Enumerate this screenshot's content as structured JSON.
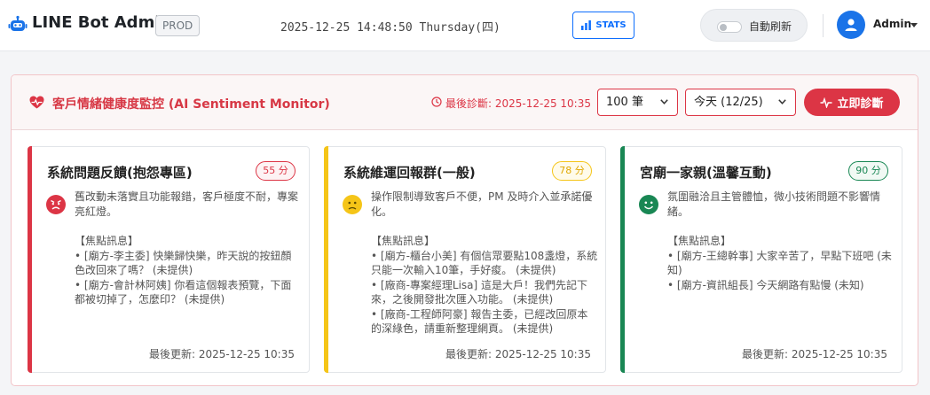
{
  "navbar": {
    "brand_icon": "robot-icon",
    "app_title": "LINE Bot Admin",
    "env_badge": "PROD",
    "clock": "2025-12-25 14:48:50 Thursday(四)",
    "stats_label": "STATS",
    "stats_icon": "bar-chart-icon",
    "auto_refresh_label": "自動刷新",
    "auto_refresh_on": false,
    "user_icon": "user-icon",
    "user_name": "Admin"
  },
  "monitor": {
    "title": "客戶情緒健康度監控 (AI Sentiment Monitor)",
    "title_icon": "heart-pulse-icon",
    "last_diag": "最後診斷: 2025-12-25 10:35",
    "count_select": "100 筆",
    "day_select": "今天 (12/25)",
    "diagnose_label": "立即診斷",
    "accent_color": "#dc3545"
  },
  "cards": [
    {
      "group": "系統問題反饋(抱怨專區)",
      "score": "55 分",
      "mood": "angry-face-icon",
      "color": "#dc3545",
      "summary": "舊改動未落實且功能報錯，客戶極度不耐，專案亮紅燈。",
      "focus_header": "【焦點訊息】",
      "focus": [
        "• [廟方-李主委] 快樂歸快樂，昨天說的按鈕顏色改回來了嗎？ (未提供)",
        "• [廟方-會計林阿姨] 你看這個報表預覽，下面都被切掉了，怎麼印？ (未提供)"
      ],
      "updated": "最後更新: 2025-12-25 10:35"
    },
    {
      "group": "系統維運回報群(一般)",
      "score": "78 分",
      "mood": "neutral-face-icon",
      "color": "#f5c518",
      "summary": "操作限制導致客戶不便，PM 及時介入並承諾優化。",
      "focus_header": "【焦點訊息】",
      "focus": [
        "• [廟方-櫃台小美] 有個信眾要點108盞燈，系統只能一次輸入10筆，手好痠。 (未提供)",
        "• [廠商-專案經理Lisa] 這是大戶！我們先記下來，之後開發批次匯入功能。 (未提供)",
        "• [廠商-工程師阿豪] 報告主委，已經改回原本的深綠色，請重新整理網頁。 (未提供)"
      ],
      "updated": "最後更新: 2025-12-25 10:35"
    },
    {
      "group": "宮廟一家親(溫馨互動)",
      "score": "90 分",
      "mood": "happy-face-icon",
      "color": "#198754",
      "summary": "氛圍融洽且主管體恤，微小技術問題不影響情緒。",
      "focus_header": "【焦點訊息】",
      "focus": [
        "• [廟方-王總幹事] 大家辛苦了，早點下班吧 (未知)",
        "• [廟方-資訊組長] 今天網路有點慢 (未知)"
      ],
      "updated": "最後更新: 2025-12-25 10:35"
    }
  ]
}
